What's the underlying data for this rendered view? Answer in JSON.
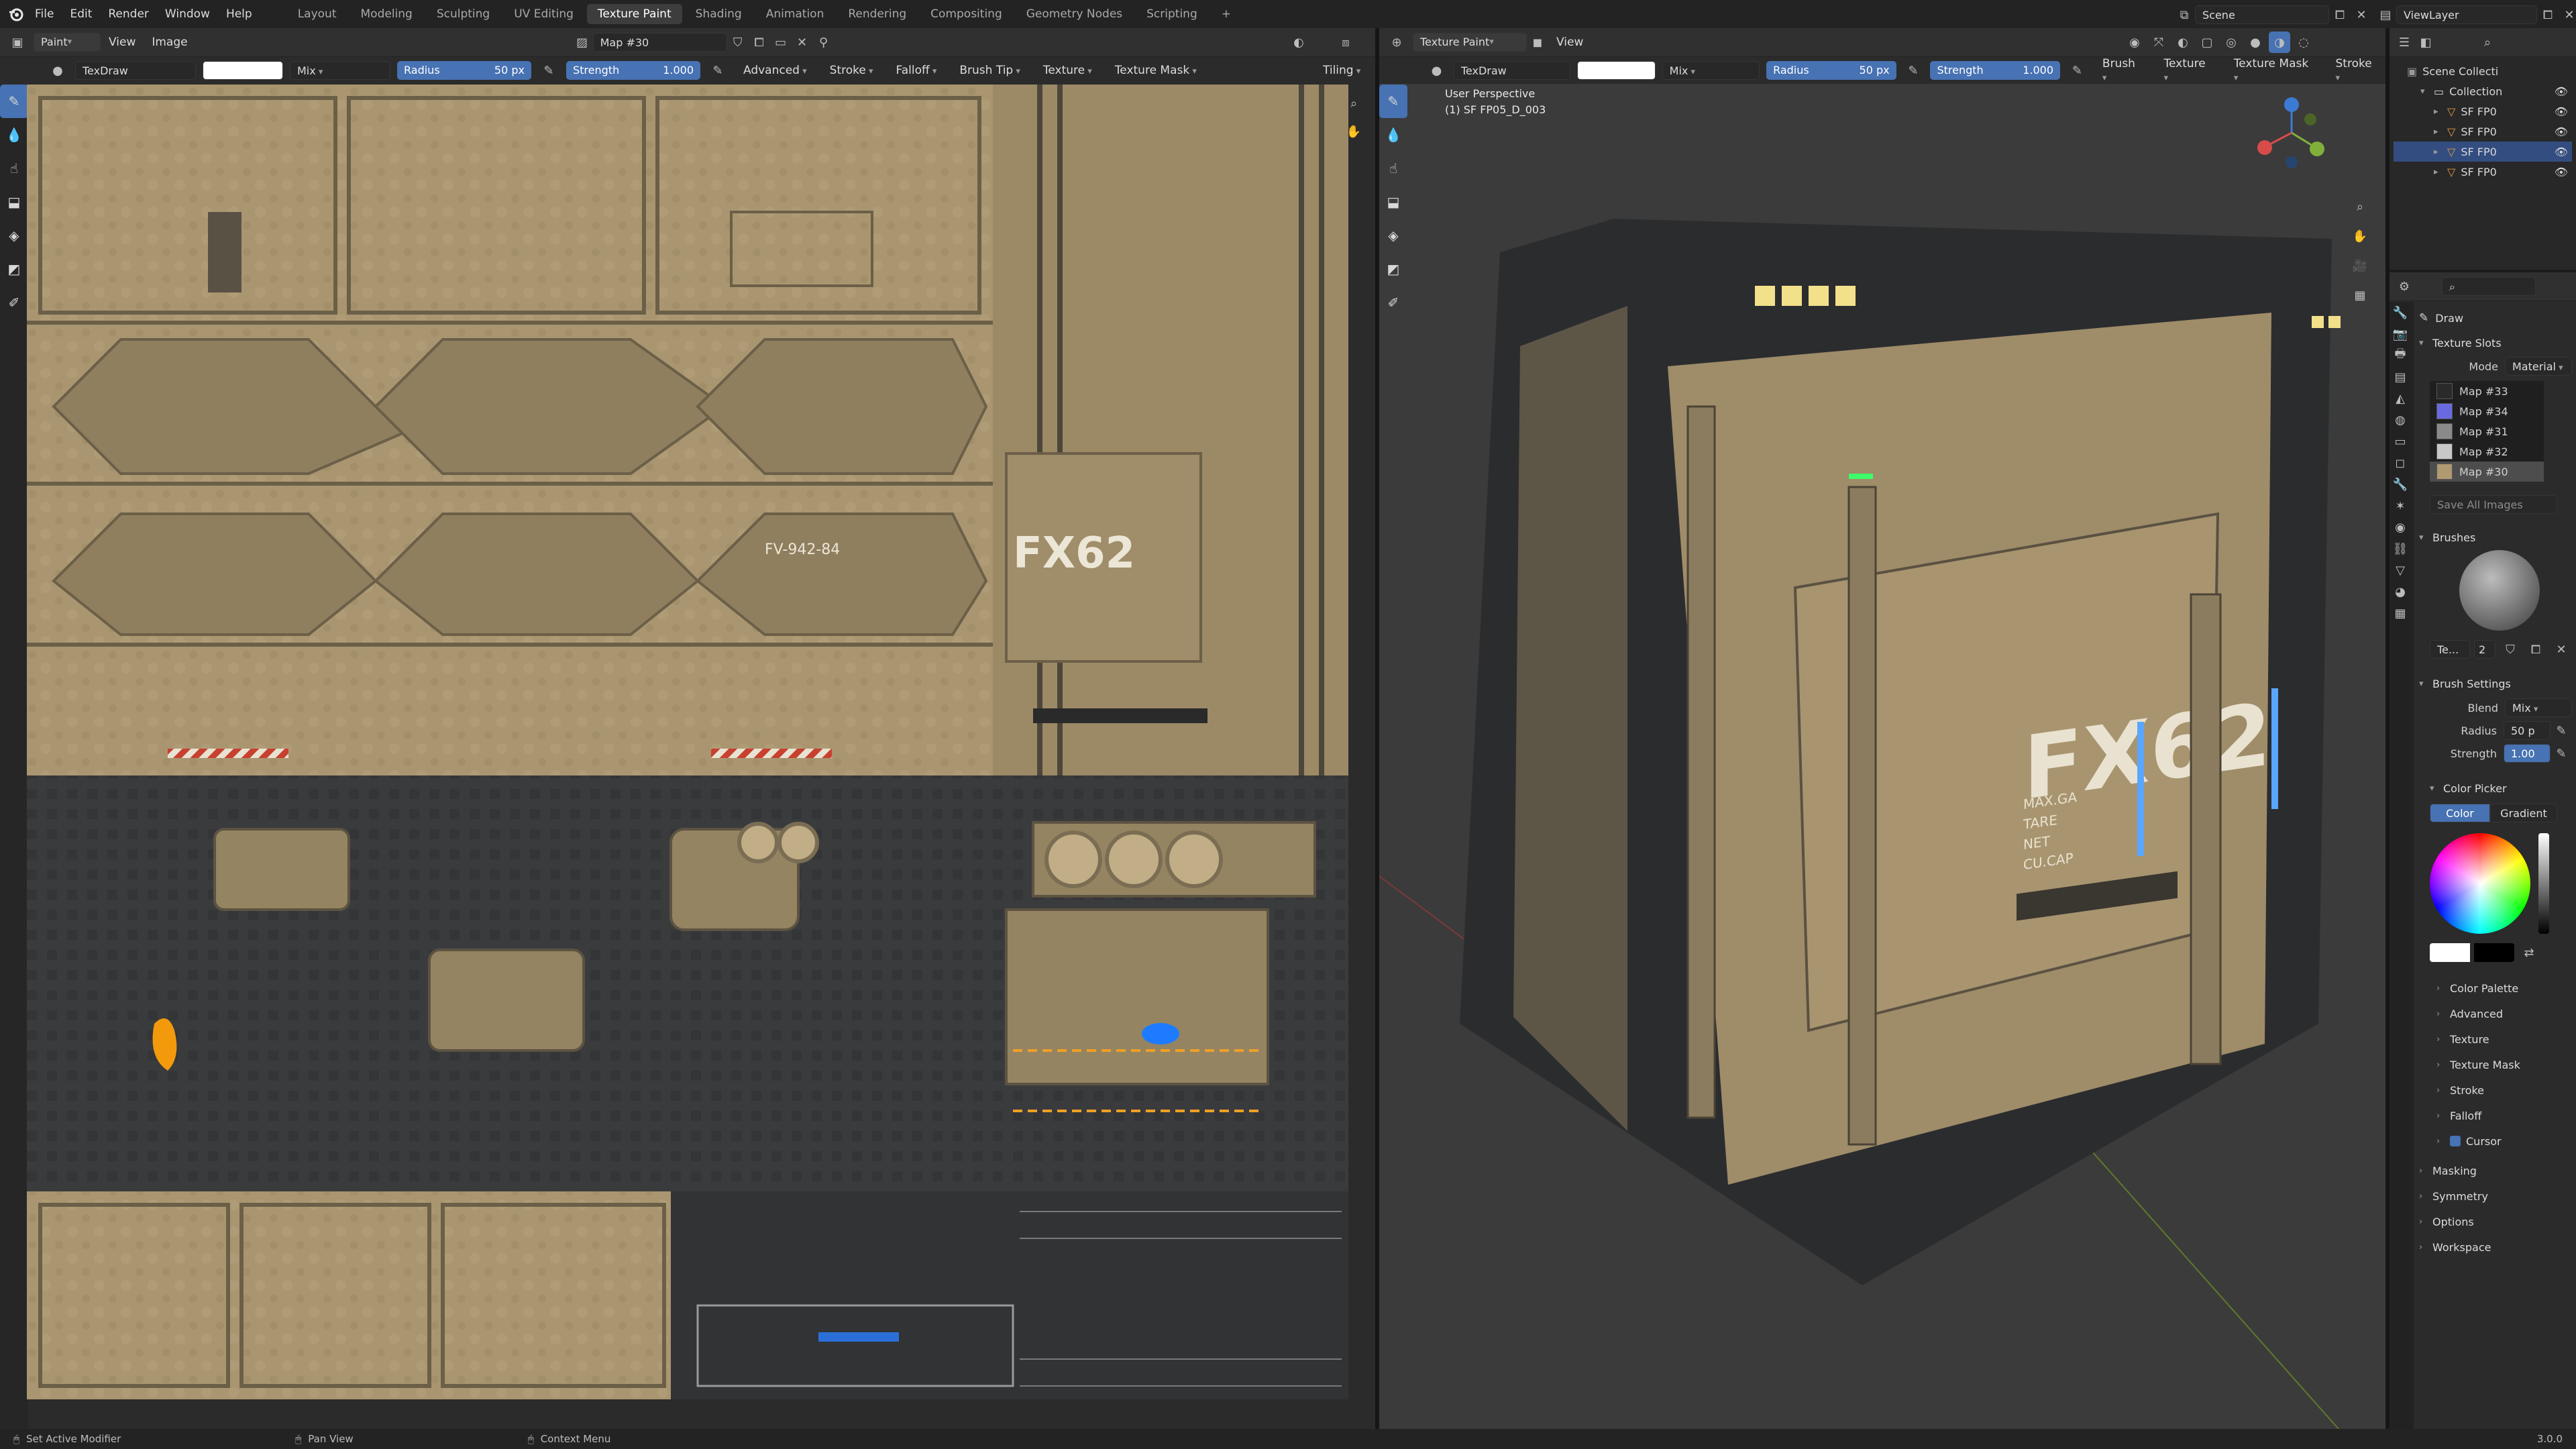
{
  "menubar": {
    "app_icon": "blender-logo-icon",
    "menus": [
      "File",
      "Edit",
      "Render",
      "Window",
      "Help"
    ],
    "workspaces": [
      "Layout",
      "Modeling",
      "Sculpting",
      "UV Editing",
      "Texture Paint",
      "Shading",
      "Animation",
      "Rendering",
      "Compositing",
      "Geometry Nodes",
      "Scripting"
    ],
    "active_workspace": "Texture Paint",
    "scene": "Scene",
    "view_layer": "ViewLayer"
  },
  "image_editor": {
    "mode": "Paint",
    "menus": [
      "View",
      "Image"
    ],
    "image_name": "Map #30",
    "tool_header": {
      "brush": "TexDraw",
      "blend": "Mix",
      "radius_label": "Radius",
      "radius_value": "50 px",
      "strength_label": "Strength",
      "strength_value": "1.000",
      "menus": [
        "Advanced",
        "Stroke",
        "Falloff",
        "Brush Tip",
        "Texture",
        "Texture Mask"
      ],
      "tiling": "Tiling"
    },
    "texture_labels": {
      "big_code": "FX62",
      "panel_code": "FV-942-84"
    }
  },
  "viewport": {
    "mode": "Texture Paint",
    "menus": [
      "View"
    ],
    "tool_header": {
      "brush": "TexDraw",
      "blend": "Mix",
      "radius_label": "Radius",
      "radius_value": "50 px",
      "strength_label": "Strength",
      "strength_value": "1.000",
      "menus": [
        "Brush",
        "Texture",
        "Texture Mask",
        "Stroke"
      ]
    },
    "overlay_line1": "User Perspective",
    "overlay_line2": "(1) SF FP05_D_003",
    "crate_code": "FX62",
    "crate_small_text": [
      "MAX.GA",
      "TARE",
      "NET",
      "CU.CAP"
    ]
  },
  "outliner": {
    "root": "Scene Collecti",
    "collection": "Collection",
    "items": [
      "SF FP0",
      "SF FP0",
      "SF FP0",
      "SF FP0"
    ]
  },
  "properties": {
    "tool_name": "Draw",
    "texture_slots": {
      "title": "Texture Slots",
      "mode_label": "Mode",
      "mode_value": "Material",
      "slots": [
        {
          "name": "Map #33",
          "color": "#2a2a2a"
        },
        {
          "name": "Map #34",
          "color": "#6a6ae0"
        },
        {
          "name": "Map #31",
          "color": "#8a8a8a"
        },
        {
          "name": "Map #32",
          "color": "#c8c8c8"
        },
        {
          "name": "Map #30",
          "color": "#b09a72"
        }
      ],
      "save_all": "Save All Images"
    },
    "brushes": {
      "title": "Brushes",
      "brush_short": "Te...",
      "users": "2"
    },
    "brush_settings": {
      "title": "Brush Settings",
      "blend_label": "Blend",
      "blend_value": "Mix",
      "radius_label": "Radius",
      "radius_value": "50 p",
      "strength_label": "Strength",
      "strength_value": "1.00"
    },
    "color_picker": {
      "title": "Color Picker",
      "tab_color": "Color",
      "tab_gradient": "Gradient"
    },
    "sub_sections": [
      "Color Palette",
      "Advanced",
      "Texture",
      "Texture Mask",
      "Stroke",
      "Falloff",
      "Cursor"
    ],
    "sections": [
      "Masking",
      "Symmetry",
      "Options",
      "Workspace"
    ]
  },
  "statusbar": {
    "left": "Set Active Modifier",
    "middle": "Pan View",
    "right": "Context Menu",
    "version": "3.0.0"
  },
  "colors": {
    "accent_blue": "#4772b3",
    "texture_tan": "#b09a72",
    "emissive_yellow": "#f2e08a",
    "emissive_blue": "#5aa6ff"
  }
}
